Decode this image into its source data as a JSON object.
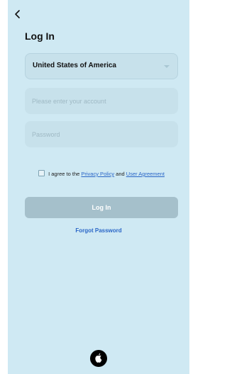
{
  "header": {
    "back_icon": "chevron-left-icon",
    "title": "Log In"
  },
  "form": {
    "country": {
      "value": "United States of America",
      "icon": "chevron-down-icon"
    },
    "account": {
      "placeholder": "Please enter your account",
      "value": ""
    },
    "password": {
      "placeholder": "Password",
      "value": ""
    },
    "agreement": {
      "checked": false,
      "prefix": "I agree to the",
      "privacy_link": "Privacy Policy",
      "conjunction": "and",
      "user_link": "User Agreement"
    },
    "login_label": "Log In",
    "forgot_label": "Forgot Password"
  },
  "social": {
    "apple_icon": "apple-icon"
  },
  "colors": {
    "background": "#cfe9f3",
    "field": "#c7e1eb",
    "button_disabled": "#a5c0cb",
    "link": "#2a66c7"
  }
}
